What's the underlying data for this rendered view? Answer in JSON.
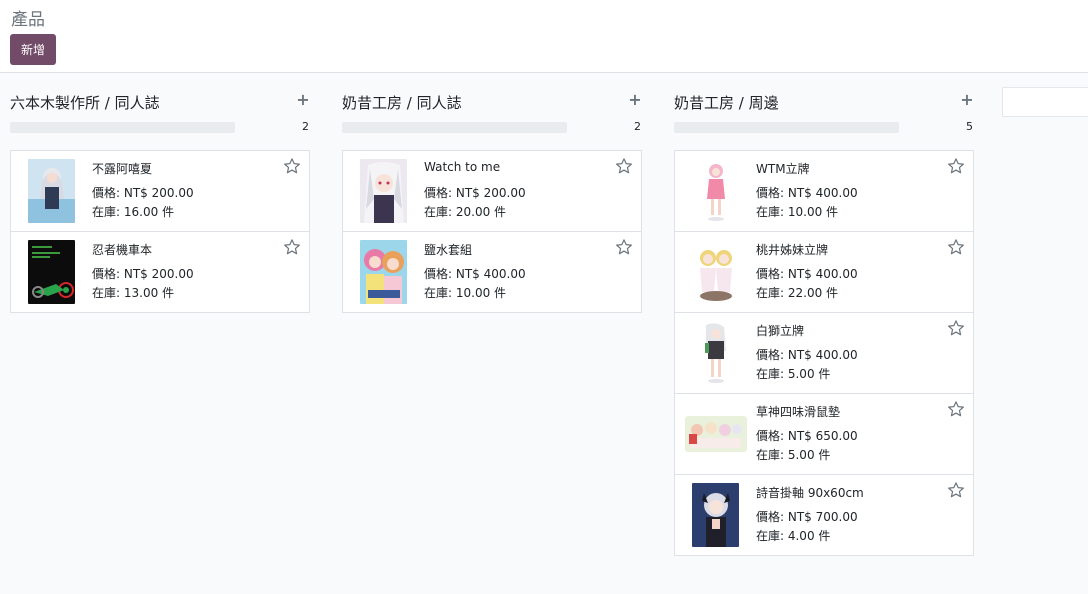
{
  "page": {
    "title": "產品",
    "new_button": "新增"
  },
  "columns": [
    {
      "title": "六本木製作所 / 同人誌",
      "count": "2",
      "cards": [
        {
          "name": "不露阿嘻夏",
          "price": "價格: NT$ 200.00",
          "stock": "在庫: 16.00 件",
          "image": "swimsuit-girl-cover"
        },
        {
          "name": "忍者機車本",
          "price": "價格: NT$ 200.00",
          "stock": "在庫: 13.00 件",
          "image": "motorcycle-cover"
        }
      ]
    },
    {
      "title": "奶昔工房 / 同人誌",
      "count": "2",
      "cards": [
        {
          "name": "Watch to me",
          "price": "價格: NT$ 200.00",
          "stock": "在庫: 20.00 件",
          "image": "white-hair-girl-cover"
        },
        {
          "name": "鹽水套組",
          "price": "價格: NT$ 400.00",
          "stock": "在庫: 10.00 件",
          "image": "two-girls-cover"
        }
      ]
    },
    {
      "title": "奶昔工房 / 周邊",
      "count": "5",
      "cards": [
        {
          "name": "WTM立牌",
          "price": "價格: NT$ 400.00",
          "stock": "在庫: 10.00 件",
          "image": "pink-standee"
        },
        {
          "name": "桃井姊妹立牌",
          "price": "價格: NT$ 400.00",
          "stock": "在庫: 22.00 件",
          "image": "sisters-standee"
        },
        {
          "name": "白獅立牌",
          "price": "價格: NT$ 400.00",
          "stock": "在庫: 5.00 件",
          "image": "white-lion-standee"
        },
        {
          "name": "草神四味滑鼠墊",
          "price": "價格: NT$ 650.00",
          "stock": "在庫: 5.00 件",
          "image": "mousepad"
        },
        {
          "name": "詩音掛軸 90x60cm",
          "price": "價格: NT$ 700.00",
          "stock": "在庫: 4.00 件",
          "image": "tapestry"
        }
      ]
    }
  ],
  "colors": {
    "primary": "#714b67",
    "star": "#6c757d"
  }
}
